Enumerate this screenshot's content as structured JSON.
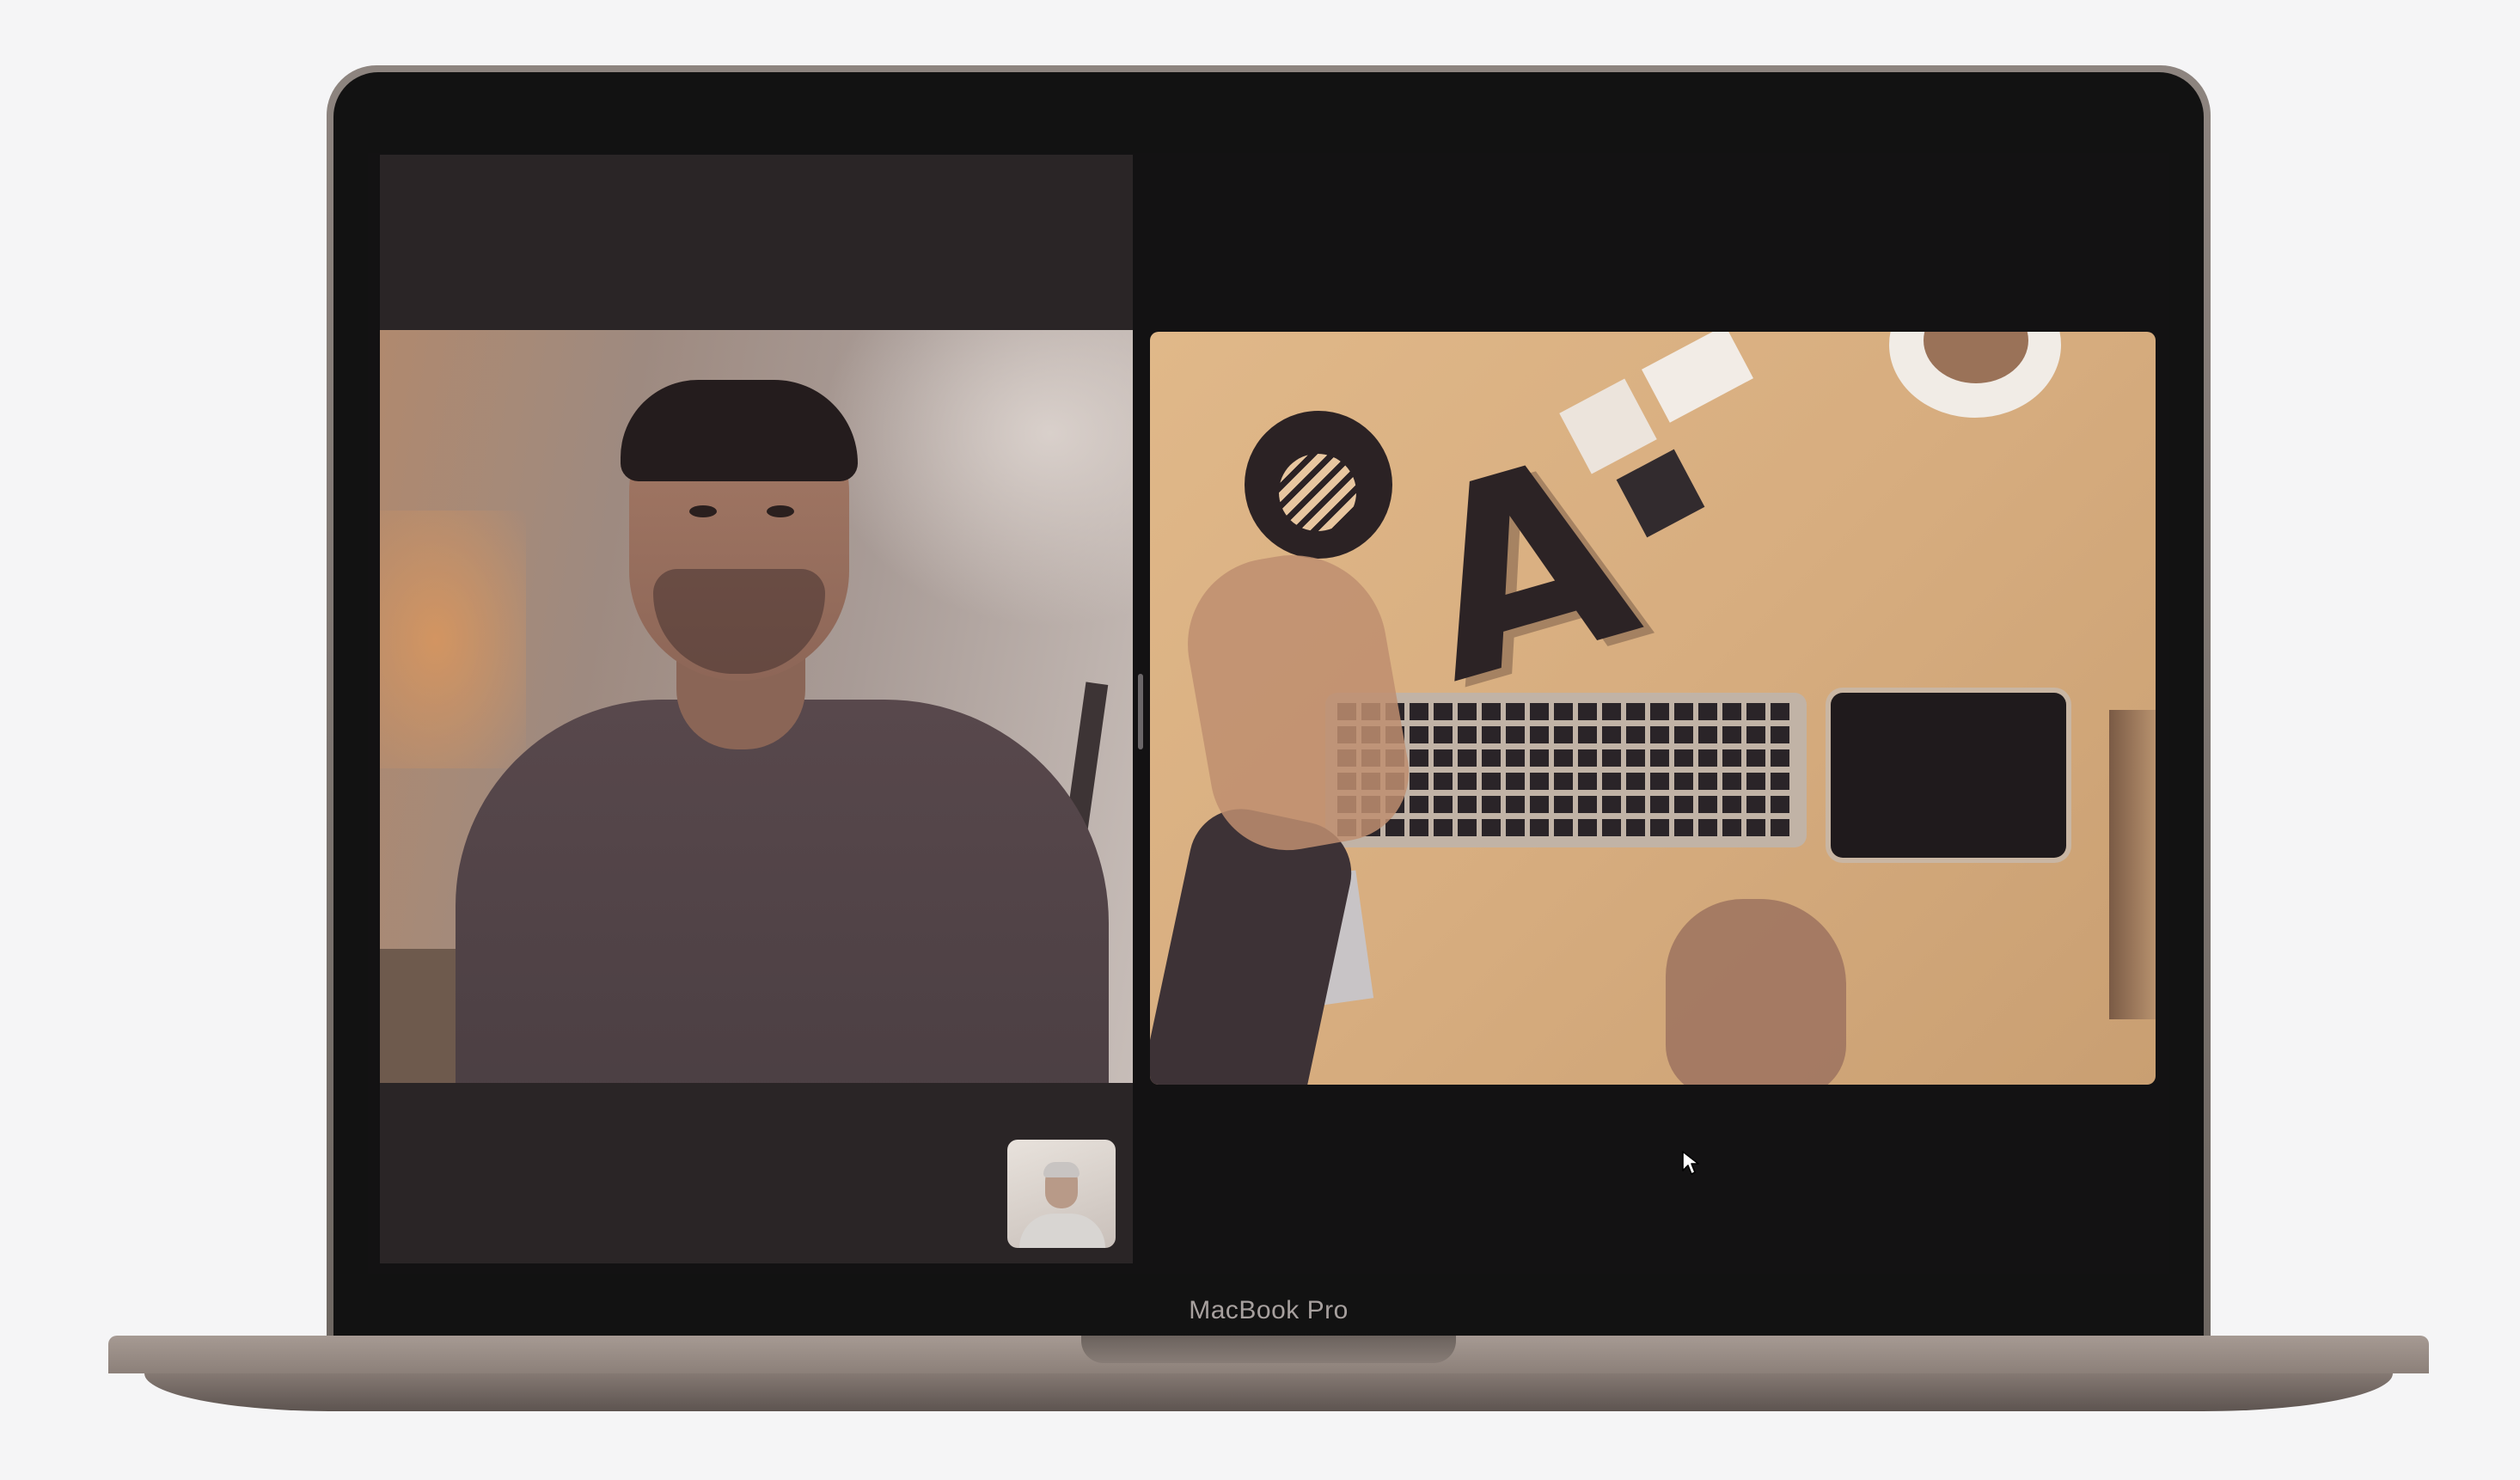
{
  "device": {
    "label": "MacBook Pro"
  },
  "facetime": {
    "remote_participant": "remote-participant-video",
    "self_view": "self-view-thumbnail",
    "shared_content": "shared-screen-video"
  },
  "icons": {
    "cursor": "arrow-cursor-icon"
  },
  "colors": {
    "background": "#f5f5f6",
    "bezel": "#121212",
    "screen": "#131213",
    "left_pane": "#2a2526",
    "desk": "#d7ad7f",
    "chassis": "#8c8079"
  }
}
